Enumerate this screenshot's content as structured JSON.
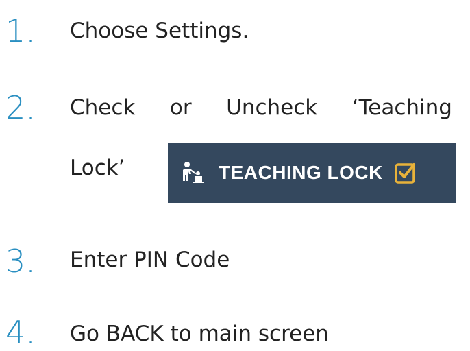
{
  "steps": [
    {
      "number": "1.",
      "text": "Choose Settings."
    },
    {
      "number": "2.",
      "words": [
        "Check",
        "or",
        "Uncheck",
        "‘Teaching"
      ],
      "continuation": "Lock’"
    },
    {
      "number": "3.",
      "text": "Enter PIN Code"
    },
    {
      "number": "4.",
      "text": "Go BACK to main screen"
    }
  ],
  "badge": {
    "label": "TEACHING LOCK",
    "background": "#34485e",
    "icon": "teacher-icon",
    "check_icon": "checked-box-icon",
    "check_color": "#e8b23a"
  },
  "colors": {
    "number": "#2a8fc1",
    "text": "#222222"
  }
}
